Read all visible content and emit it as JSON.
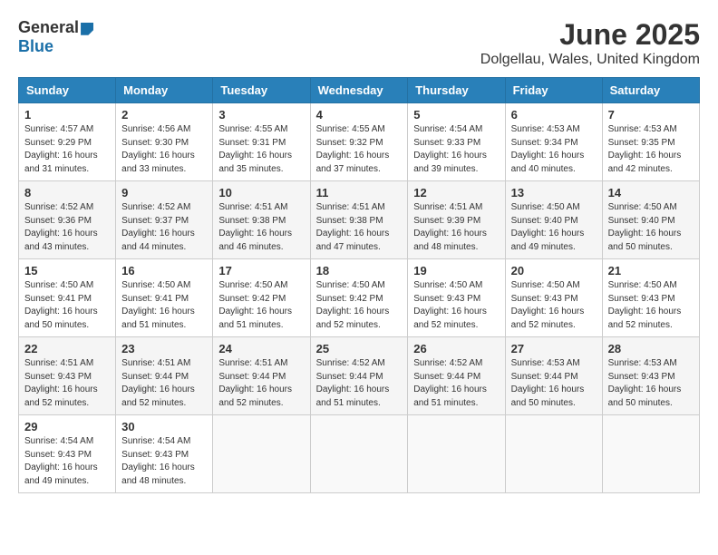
{
  "logo": {
    "general": "General",
    "blue": "Blue"
  },
  "title": "June 2025",
  "location": "Dolgellau, Wales, United Kingdom",
  "headers": [
    "Sunday",
    "Monday",
    "Tuesday",
    "Wednesday",
    "Thursday",
    "Friday",
    "Saturday"
  ],
  "weeks": [
    [
      {
        "day": "1",
        "sunrise": "4:57 AM",
        "sunset": "9:29 PM",
        "daylight": "16 hours and 31 minutes."
      },
      {
        "day": "2",
        "sunrise": "4:56 AM",
        "sunset": "9:30 PM",
        "daylight": "16 hours and 33 minutes."
      },
      {
        "day": "3",
        "sunrise": "4:55 AM",
        "sunset": "9:31 PM",
        "daylight": "16 hours and 35 minutes."
      },
      {
        "day": "4",
        "sunrise": "4:55 AM",
        "sunset": "9:32 PM",
        "daylight": "16 hours and 37 minutes."
      },
      {
        "day": "5",
        "sunrise": "4:54 AM",
        "sunset": "9:33 PM",
        "daylight": "16 hours and 39 minutes."
      },
      {
        "day": "6",
        "sunrise": "4:53 AM",
        "sunset": "9:34 PM",
        "daylight": "16 hours and 40 minutes."
      },
      {
        "day": "7",
        "sunrise": "4:53 AM",
        "sunset": "9:35 PM",
        "daylight": "16 hours and 42 minutes."
      }
    ],
    [
      {
        "day": "8",
        "sunrise": "4:52 AM",
        "sunset": "9:36 PM",
        "daylight": "16 hours and 43 minutes."
      },
      {
        "day": "9",
        "sunrise": "4:52 AM",
        "sunset": "9:37 PM",
        "daylight": "16 hours and 44 minutes."
      },
      {
        "day": "10",
        "sunrise": "4:51 AM",
        "sunset": "9:38 PM",
        "daylight": "16 hours and 46 minutes."
      },
      {
        "day": "11",
        "sunrise": "4:51 AM",
        "sunset": "9:38 PM",
        "daylight": "16 hours and 47 minutes."
      },
      {
        "day": "12",
        "sunrise": "4:51 AM",
        "sunset": "9:39 PM",
        "daylight": "16 hours and 48 minutes."
      },
      {
        "day": "13",
        "sunrise": "4:50 AM",
        "sunset": "9:40 PM",
        "daylight": "16 hours and 49 minutes."
      },
      {
        "day": "14",
        "sunrise": "4:50 AM",
        "sunset": "9:40 PM",
        "daylight": "16 hours and 50 minutes."
      }
    ],
    [
      {
        "day": "15",
        "sunrise": "4:50 AM",
        "sunset": "9:41 PM",
        "daylight": "16 hours and 50 minutes."
      },
      {
        "day": "16",
        "sunrise": "4:50 AM",
        "sunset": "9:41 PM",
        "daylight": "16 hours and 51 minutes."
      },
      {
        "day": "17",
        "sunrise": "4:50 AM",
        "sunset": "9:42 PM",
        "daylight": "16 hours and 51 minutes."
      },
      {
        "day": "18",
        "sunrise": "4:50 AM",
        "sunset": "9:42 PM",
        "daylight": "16 hours and 52 minutes."
      },
      {
        "day": "19",
        "sunrise": "4:50 AM",
        "sunset": "9:43 PM",
        "daylight": "16 hours and 52 minutes."
      },
      {
        "day": "20",
        "sunrise": "4:50 AM",
        "sunset": "9:43 PM",
        "daylight": "16 hours and 52 minutes."
      },
      {
        "day": "21",
        "sunrise": "4:50 AM",
        "sunset": "9:43 PM",
        "daylight": "16 hours and 52 minutes."
      }
    ],
    [
      {
        "day": "22",
        "sunrise": "4:51 AM",
        "sunset": "9:43 PM",
        "daylight": "16 hours and 52 minutes."
      },
      {
        "day": "23",
        "sunrise": "4:51 AM",
        "sunset": "9:44 PM",
        "daylight": "16 hours and 52 minutes."
      },
      {
        "day": "24",
        "sunrise": "4:51 AM",
        "sunset": "9:44 PM",
        "daylight": "16 hours and 52 minutes."
      },
      {
        "day": "25",
        "sunrise": "4:52 AM",
        "sunset": "9:44 PM",
        "daylight": "16 hours and 51 minutes."
      },
      {
        "day": "26",
        "sunrise": "4:52 AM",
        "sunset": "9:44 PM",
        "daylight": "16 hours and 51 minutes."
      },
      {
        "day": "27",
        "sunrise": "4:53 AM",
        "sunset": "9:44 PM",
        "daylight": "16 hours and 50 minutes."
      },
      {
        "day": "28",
        "sunrise": "4:53 AM",
        "sunset": "9:43 PM",
        "daylight": "16 hours and 50 minutes."
      }
    ],
    [
      {
        "day": "29",
        "sunrise": "4:54 AM",
        "sunset": "9:43 PM",
        "daylight": "16 hours and 49 minutes."
      },
      {
        "day": "30",
        "sunrise": "4:54 AM",
        "sunset": "9:43 PM",
        "daylight": "16 hours and 48 minutes."
      },
      null,
      null,
      null,
      null,
      null
    ]
  ]
}
